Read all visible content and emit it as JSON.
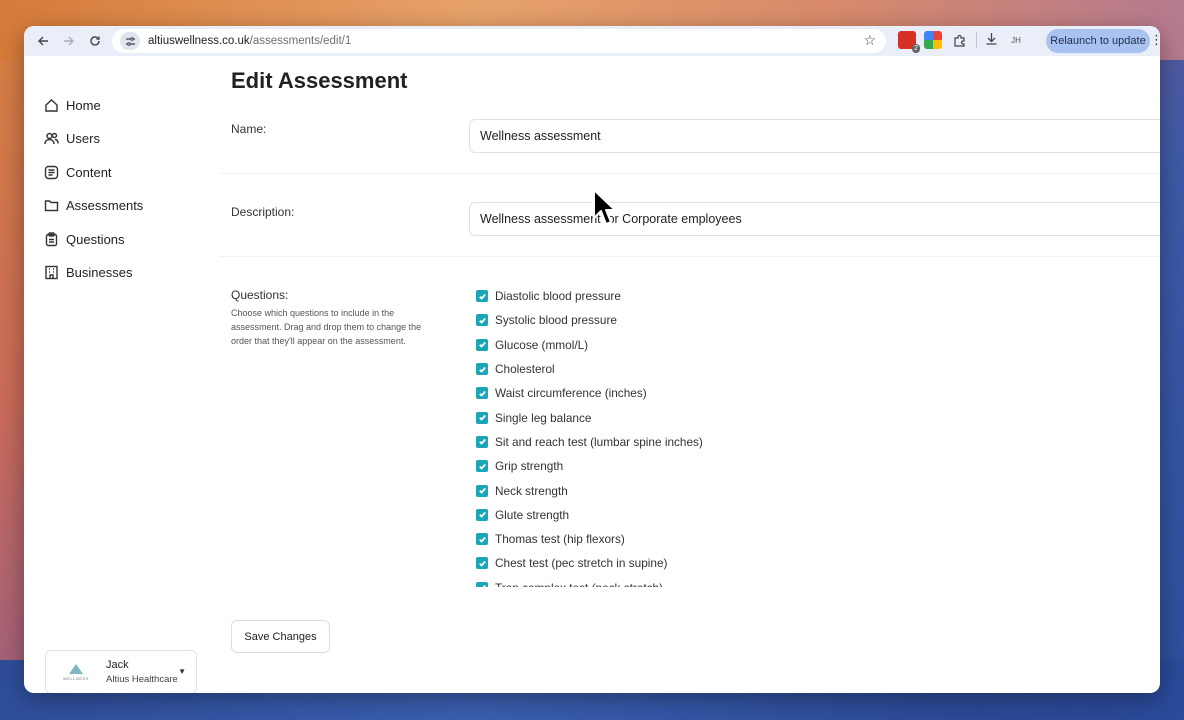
{
  "browser": {
    "url_host": "altiuswellness.co.uk",
    "url_path": "/assessments/edit/1",
    "ext_badge_count": "2",
    "avatar_initials": "JH",
    "relaunch_label": "Relaunch to update"
  },
  "sidebar": {
    "items": [
      {
        "label": "Home",
        "icon": "home-icon"
      },
      {
        "label": "Users",
        "icon": "users-icon"
      },
      {
        "label": "Content",
        "icon": "content-icon"
      },
      {
        "label": "Assessments",
        "icon": "folder-icon"
      },
      {
        "label": "Questions",
        "icon": "clipboard-icon"
      },
      {
        "label": "Businesses",
        "icon": "building-icon"
      }
    ],
    "account": {
      "name": "Jack",
      "org": "Altius Healthcare",
      "logo_text": "WELLNESS"
    }
  },
  "main": {
    "title": "Edit Assessment",
    "name_label": "Name:",
    "name_value": "Wellness assessment",
    "description_label": "Description:",
    "description_value": "Wellness assessment for Corporate employees",
    "questions_label": "Questions:",
    "questions_help": "Choose which questions to include in the assessment. Drag and drop them to change the order that they'll appear on the assessment.",
    "questions": [
      "Diastolic blood pressure",
      "Systolic blood pressure",
      "Glucose (mmol/L)",
      "Cholesterol",
      "Waist circumference (inches)",
      "Single leg balance",
      "Sit and reach test (lumbar spine inches)",
      "Grip strength",
      "Neck strength",
      "Glute strength",
      "Thomas test (hip flexors)",
      "Chest test (pec stretch in supine)",
      "Trap complex test (neck stretch)"
    ],
    "save_label": "Save Changes"
  },
  "colors": {
    "checkbox": "#1aa6b7",
    "toolbar": "#e9eef8",
    "relaunch": "#a9c3f0"
  }
}
